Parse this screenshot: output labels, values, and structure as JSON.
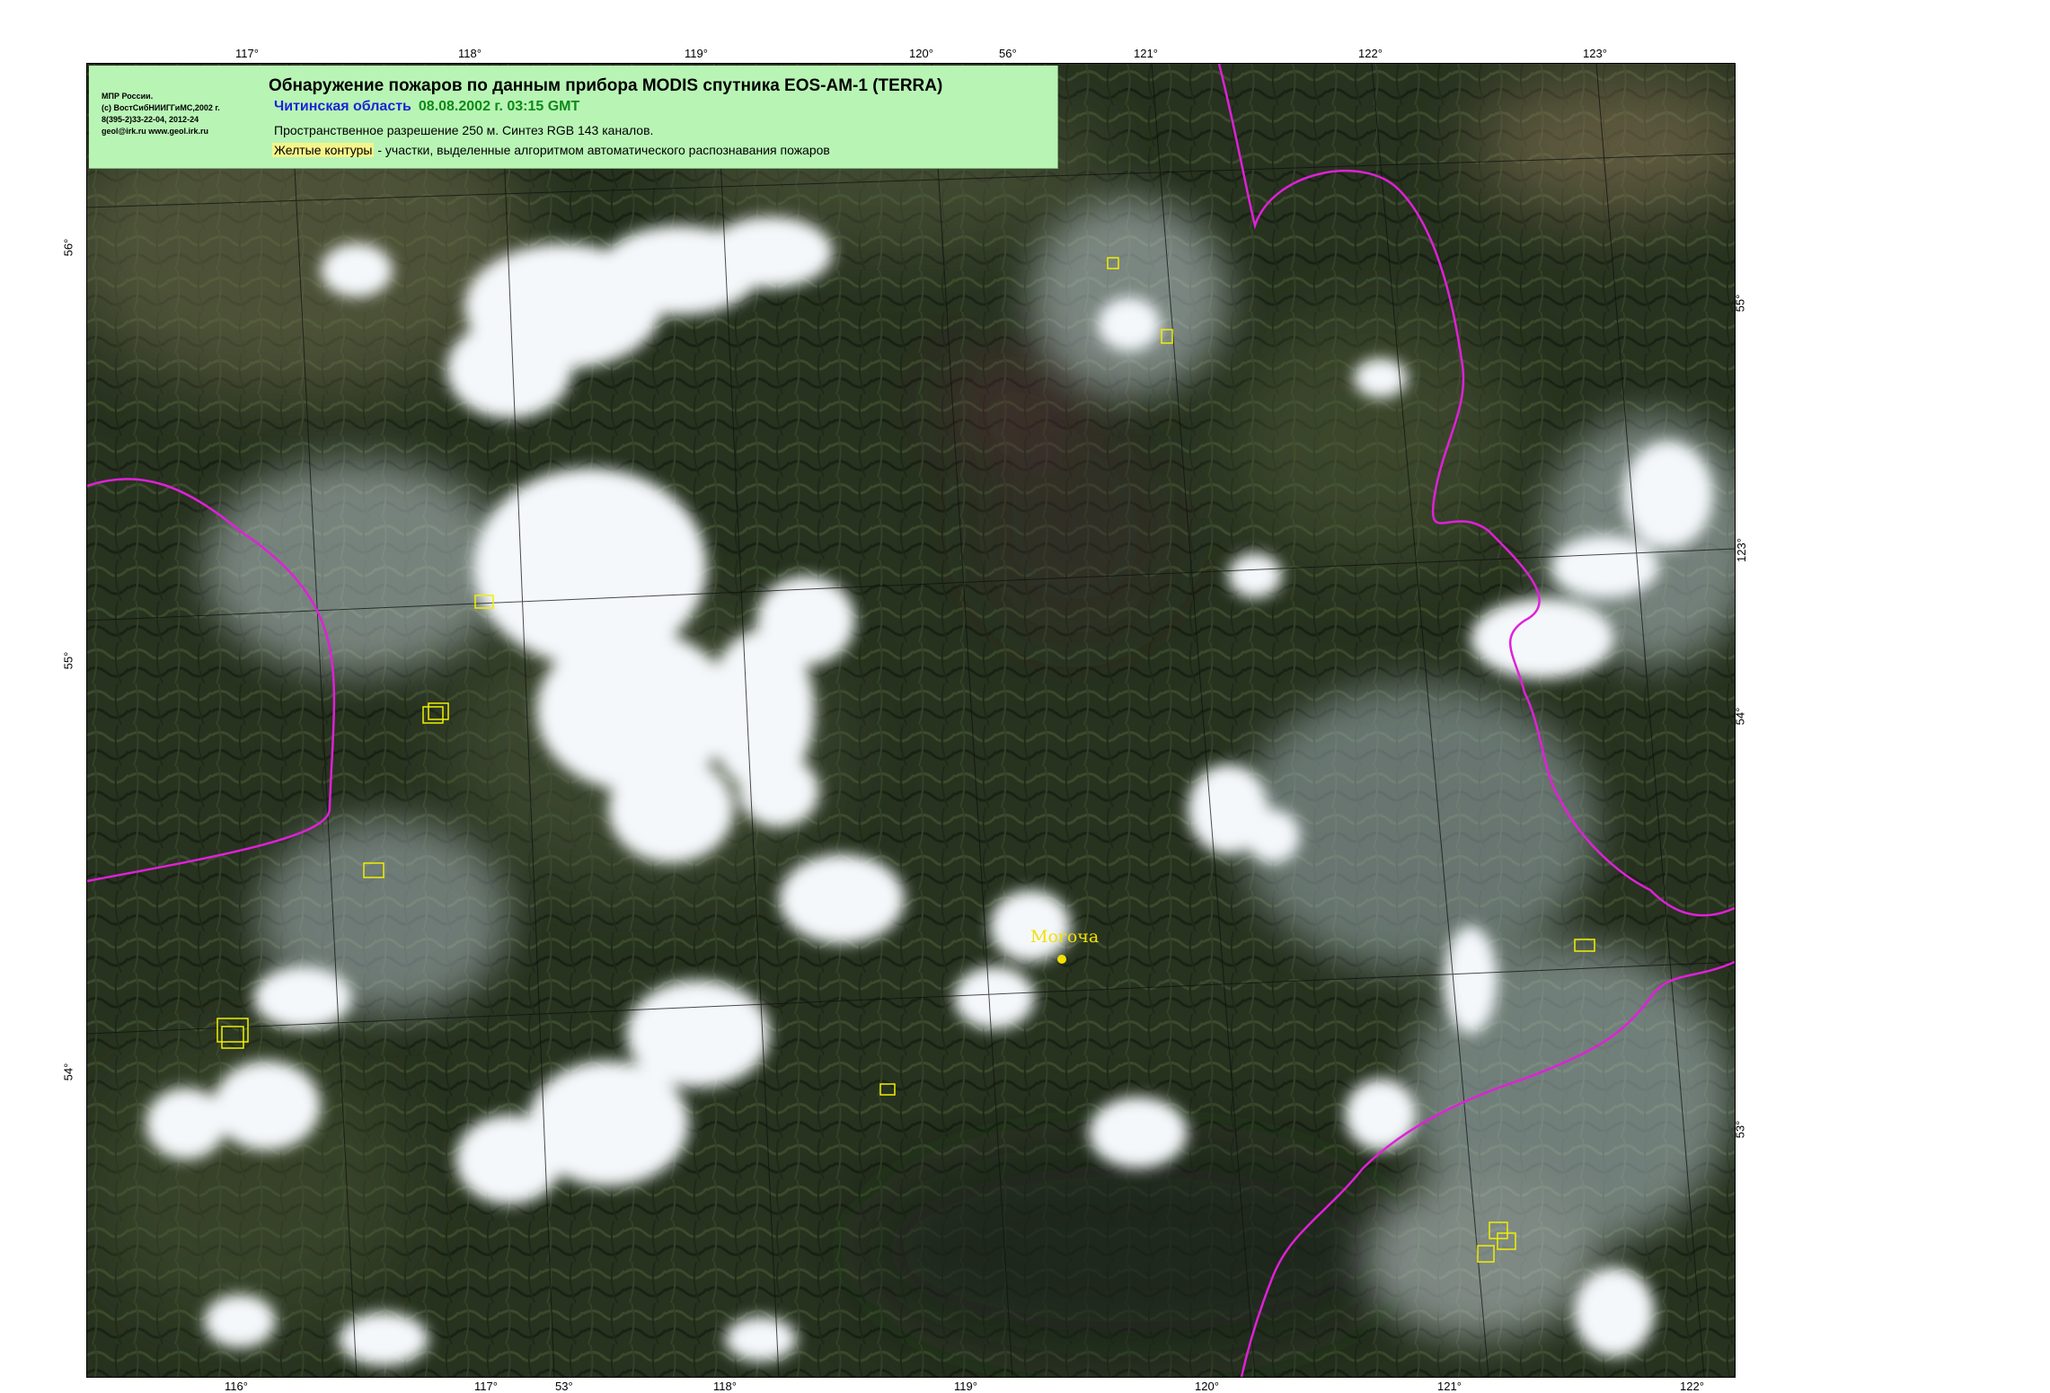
{
  "legend": {
    "title": "Обнаружение пожаров по данным прибора MODIS спутника EOS-AM-1 (TERRA)",
    "region": "Читинская область",
    "datetime": "08.08.2002 г. 03:15 GMT",
    "resolution": "Пространственное разрешение 250 м. Синтез RGB 143 каналов.",
    "contours_highlight": "Желтые контуры",
    "contours_rest": " - участки, выделенные алгоритмом автоматического распознавания пожаров",
    "credits": [
      "МПР России.",
      "(с) ВостСибНИИГГиМС,2002 г.",
      "8(395-2)33-22-04, 2012-24",
      "geol@irk.ru  www.geol.irk.ru"
    ]
  },
  "top_ticks": [
    "117°",
    "118°",
    "119°",
    "120°",
    "56°",
    "121°",
    "122°",
    "123°"
  ],
  "bottom_ticks": [
    "116°",
    "117°",
    "53°",
    "118°",
    "119°",
    "120°",
    "121°",
    "122°"
  ],
  "left_ticks": [
    "56°",
    "55°",
    "54°"
  ],
  "right_ticks": [
    "55°",
    "123°",
    "54°",
    "53°"
  ],
  "city": {
    "name": "Могоча"
  },
  "colors": {
    "border": "#e020d8",
    "fire_contour": "#f2f000",
    "legend_bg": "#b8f5b5",
    "region_text": "#1d24d6",
    "date_text": "#0c8a17"
  }
}
